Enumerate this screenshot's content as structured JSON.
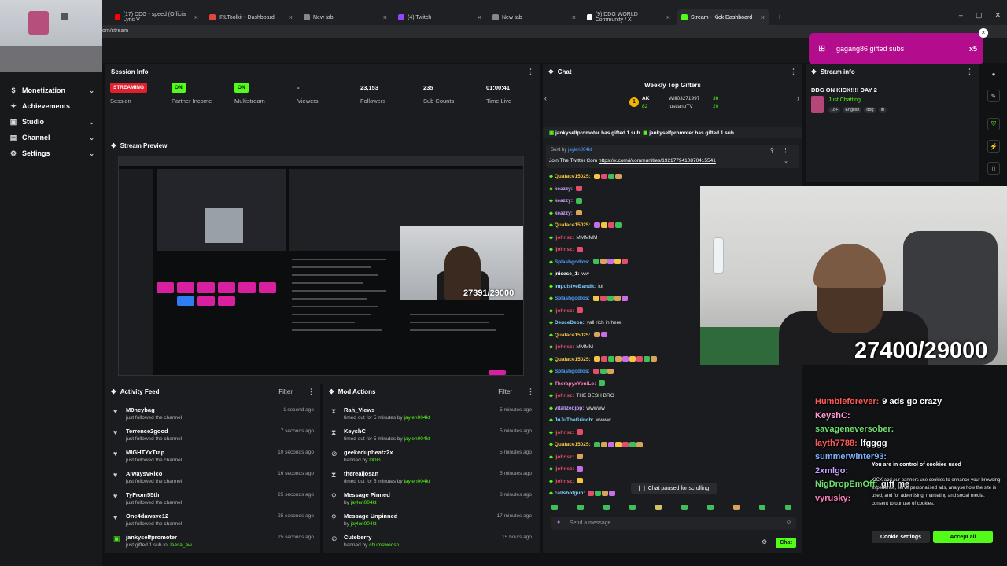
{
  "browser": {
    "tabs": [
      {
        "label": "(17) DDG - speed (Official Lyric V",
        "color": "#ff0000"
      },
      {
        "label": "IRLToolkit • Dashboard",
        "color": "#e0463c"
      },
      {
        "label": "New tab",
        "color": "#888888"
      },
      {
        "label": "(4) Twitch",
        "color": "#9146ff"
      },
      {
        "label": "New tab",
        "color": "#888888"
      },
      {
        "label": "(9) DDG WORLD Community / X",
        "color": "#ffffff"
      },
      {
        "label": "Stream - Kick Dashboard",
        "color": "#53fc18"
      }
    ],
    "url": "om/stream"
  },
  "sidebar": {
    "items": [
      {
        "label": "Monetization",
        "icon": "dollar-icon"
      },
      {
        "label": "Achievements",
        "icon": "trophy-icon"
      },
      {
        "label": "Studio",
        "icon": "studio-icon"
      },
      {
        "label": "Channel",
        "icon": "channel-icon"
      },
      {
        "label": "Settings",
        "icon": "gear-icon"
      }
    ]
  },
  "session": {
    "title": "Session Info",
    "stats": [
      {
        "value": "STREAMING",
        "label": "Session",
        "kind": "live"
      },
      {
        "value": "ON",
        "label": "Partner Income",
        "kind": "on"
      },
      {
        "value": "ON",
        "label": "Multistream",
        "kind": "on"
      },
      {
        "value": "-",
        "label": "Viewers",
        "kind": "text"
      },
      {
        "value": "23,153",
        "label": "Followers",
        "kind": "text"
      },
      {
        "value": "235",
        "label": "Sub Counts",
        "kind": "text"
      },
      {
        "value": "01:00:41",
        "label": "Time Live",
        "kind": "text"
      }
    ]
  },
  "preview": {
    "title": "Stream Preview",
    "counter": "27391/29000"
  },
  "activity": {
    "title": "Activity Feed",
    "filter": "Filter",
    "rows": [
      {
        "name": "M0neybag",
        "sub": "just followed the channel",
        "time": "1 second ago"
      },
      {
        "name": "Terrence2good",
        "sub": "just followed the channel",
        "time": "7 seconds ago"
      },
      {
        "name": "MIGHTYxTrap",
        "sub": "just followed the channel",
        "time": "10 seconds ago"
      },
      {
        "name": "AlwaysvRico",
        "sub": "just followed the channel",
        "time": "16 seconds ago"
      },
      {
        "name": "TyFrom55th",
        "sub": "just followed the channel",
        "time": "25 seconds ago"
      },
      {
        "name": "One4dawave12",
        "sub": "just followed the channel",
        "time": "25 seconds ago"
      },
      {
        "name": "jankyselfpromoter",
        "sub": "just gifted 1 sub to:",
        "sub_target": "leasa_aw",
        "time": "25 seconds ago"
      }
    ]
  },
  "mod": {
    "title": "Mod Actions",
    "filter": "Filter",
    "rows": [
      {
        "name": "Rah_Views",
        "sub": "timed out for 5 minutes by",
        "by": "jaylen004kt",
        "time": "5 minutes ago"
      },
      {
        "name": "KeyshC",
        "sub": "timed out for 5 minutes by",
        "by": "jaylen004kt",
        "time": "5 minutes ago"
      },
      {
        "name": "geekedupbeatz2x",
        "sub": "banned by",
        "by": "DDG",
        "time": "5 minutes ago"
      },
      {
        "name": "therealjosan",
        "sub": "timed out for 5 minutes by",
        "by": "jaylen004kt",
        "time": "5 minutes ago"
      },
      {
        "name": "Message Pinned",
        "sub": "by",
        "by": "jaylen004kt",
        "time": "8 minutes ago"
      },
      {
        "name": "Message Unpinned",
        "sub": "by",
        "by": "jaylen004kt",
        "time": "17 minutes ago"
      },
      {
        "name": "Cuteberry",
        "sub": "banned by",
        "by": "chumswoosh",
        "time": "15 hours ago"
      }
    ]
  },
  "chat": {
    "title": "Chat",
    "top_gifters_title": "Weekly Top Gifters",
    "gifters": [
      {
        "name": "AK",
        "count": "82"
      },
      {
        "name": "Will03271997",
        "count": "36"
      },
      {
        "name": "justjanoTV",
        "count": "20"
      }
    ],
    "gift_banner": "jankyselfpromoter has gifted 1 sub",
    "pinned_by": "Sent by",
    "pinned_user": "jaylen004kt",
    "pinned_text": "Join The Twitter Com",
    "pinned_link": "https://x.com/i/communities/1921779410870415541",
    "lines": [
      {
        "user": "Quaface15025:",
        "text": "",
        "color": "#f4c542",
        "emotes": 4
      },
      {
        "user": "keazzy:",
        "text": "",
        "color": "#c8a2ff",
        "emotes": 1
      },
      {
        "user": "keazzy:",
        "text": "",
        "color": "#c8a2ff",
        "emotes": 1
      },
      {
        "user": "keazzy:",
        "text": "",
        "color": "#c8a2ff",
        "emotes": 1
      },
      {
        "user": "Quaface15025:",
        "text": "",
        "color": "#f4c542",
        "emotes": 4
      },
      {
        "user": "ijohnsz:",
        "text": "MMMMM",
        "color": "#e44d6c",
        "emotes": 0
      },
      {
        "user": "ijohnsz:",
        "text": "",
        "color": "#e44d6c",
        "emotes": 1
      },
      {
        "user": "Splashgodlos:",
        "text": "",
        "color": "#4ea1ff",
        "emotes": 5
      },
      {
        "user": "jnicese_1:",
        "text": "ww",
        "color": "#ffffff",
        "emotes": 0
      },
      {
        "user": "ImpulsiveBandit:",
        "text": "lol",
        "color": "#7fd1ff",
        "emotes": 0
      },
      {
        "user": "Splashgodlos:",
        "text": "",
        "color": "#4ea1ff",
        "emotes": 5
      },
      {
        "user": "ijohnsz:",
        "text": "",
        "color": "#e44d6c",
        "emotes": 1
      },
      {
        "user": "DeuceDeon:",
        "text": "yall rich in here",
        "color": "#7fd1ff",
        "emotes": 0
      },
      {
        "user": "Quaface15025:",
        "text": "",
        "color": "#f4c542",
        "emotes": 2
      },
      {
        "user": "ijohnsz:",
        "text": "MMMM",
        "color": "#e44d6c",
        "emotes": 0
      },
      {
        "user": "Quaface15025:",
        "text": "",
        "color": "#f4c542",
        "emotes": 9
      },
      {
        "user": "Splashgodlos:",
        "text": "",
        "color": "#4ea1ff",
        "emotes": 3
      },
      {
        "user": "TherapyxYoniLo:",
        "text": "",
        "color": "#ff7fbf",
        "emotes": 1
      },
      {
        "user": "ijohnsz:",
        "text": "THE BESH BRO",
        "color": "#e44d6c",
        "emotes": 0
      },
      {
        "user": "vitalizedjpp:",
        "text": "wwwww",
        "color": "#c8a2ff",
        "emotes": 0
      },
      {
        "user": "JuJuTheGrinch:",
        "text": "wwww",
        "color": "#7fd1ff",
        "emotes": 0
      },
      {
        "user": "ijohnsz:",
        "text": "",
        "color": "#e44d6c",
        "emotes": 1
      },
      {
        "user": "Quaface15025:",
        "text": "",
        "color": "#f4c542",
        "emotes": 7
      },
      {
        "user": "ijohnsz:",
        "text": "",
        "color": "#e44d6c",
        "emotes": 1
      },
      {
        "user": "ijohnsz:",
        "text": "",
        "color": "#e44d6c",
        "emotes": 1
      },
      {
        "user": "ijohnsz:",
        "text": "",
        "color": "#e44d6c",
        "emotes": 1
      },
      {
        "user": "callshotgun:",
        "text": "",
        "color": "#7fd1ff",
        "emotes": 4
      }
    ],
    "paused": "Chat paused for scrolling",
    "input_placeholder": "Send a message",
    "send_label": "Chat"
  },
  "streaminfo": {
    "title": "Stream info",
    "stream_title": "DDG ON KICK!!!! DAY 2",
    "category": "Just Chatting",
    "tags": [
      "18+",
      "English",
      "ddg",
      "irl"
    ]
  },
  "gift_toast": {
    "text": "gagang86 gifted subs",
    "count": "x5"
  },
  "cam": {
    "counter": "27400/29000"
  },
  "overlay_chat": [
    {
      "user": "Humbleforever:",
      "text": "9 ads go crazy",
      "color": "#ff5a5a"
    },
    {
      "user": "KeyshC:",
      "text": "",
      "color": "#ff9ad5"
    },
    {
      "user": "savageneversober:",
      "text": "",
      "color": "#6fe06f"
    },
    {
      "user": "layth7788:",
      "text": "lfgggg",
      "color": "#ff5a5a"
    },
    {
      "user": "summerwinter93:",
      "text": "",
      "color": "#7fb2ff"
    },
    {
      "user": "2xmlgo:",
      "text": "",
      "color": "#c8a2ff"
    },
    {
      "user": "NigDropEmOff:",
      "text": "gift me",
      "color": "#6fe06f"
    },
    {
      "user": "vyrusky:",
      "text": "",
      "color": "#ff7fbf"
    }
  ],
  "cookie": {
    "title": "You are in control of cookies used",
    "body": "KICK and our partners use cookies to enhance your browsing experience, serve personalised ads, analyse how the site is used, and for advertising, marketing and social media. consent to our use of cookies.",
    "settings_label": "Cookie settings",
    "accept_label": "Accept all"
  },
  "colors": {
    "accent": "#53fc18",
    "live": "#e21f2f",
    "gift": "#b30c8d",
    "bg": "#111214",
    "panel": "#1b1c1f"
  }
}
